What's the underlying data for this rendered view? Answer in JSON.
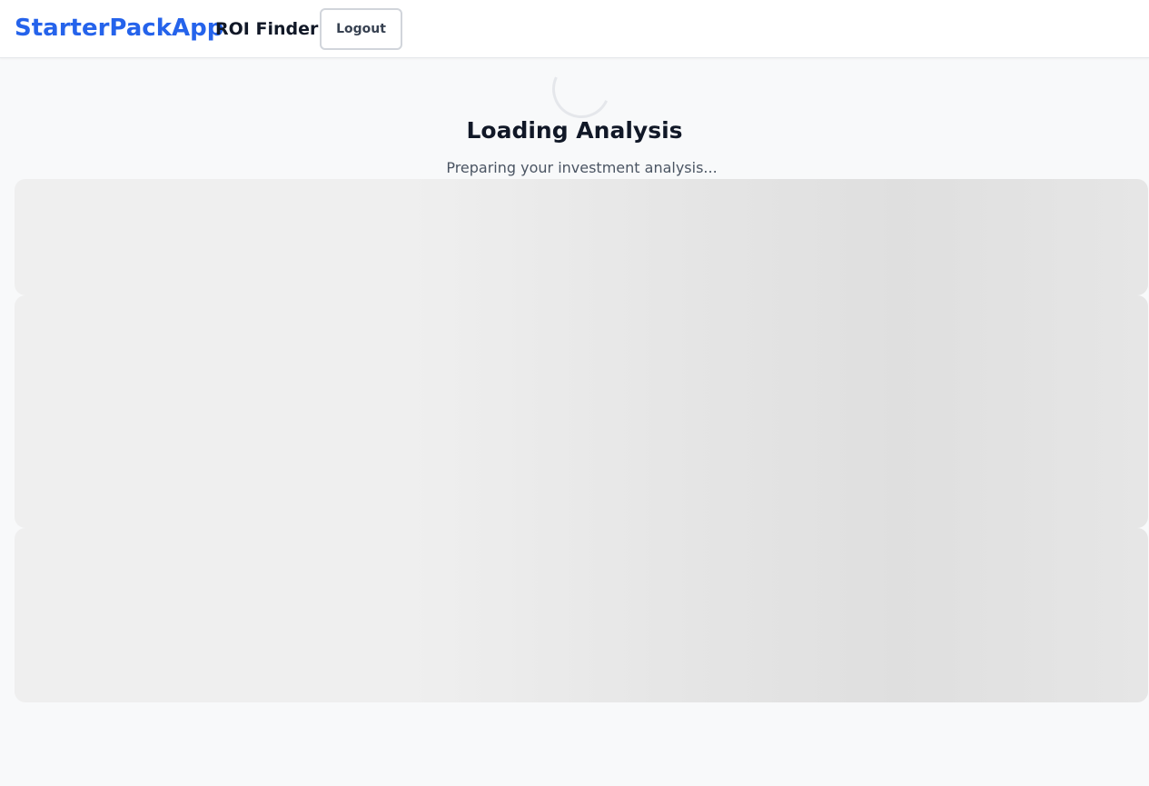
{
  "header": {
    "brand": "StarterPackApp",
    "subtitle": "ROI Finder",
    "logout_label": "Logout"
  },
  "loading": {
    "title": "Loading Analysis",
    "message": "Preparing your investment analysis..."
  },
  "colors": {
    "brand": "#2563eb",
    "background": "#f8f9fa",
    "skeleton": "#efefef"
  }
}
